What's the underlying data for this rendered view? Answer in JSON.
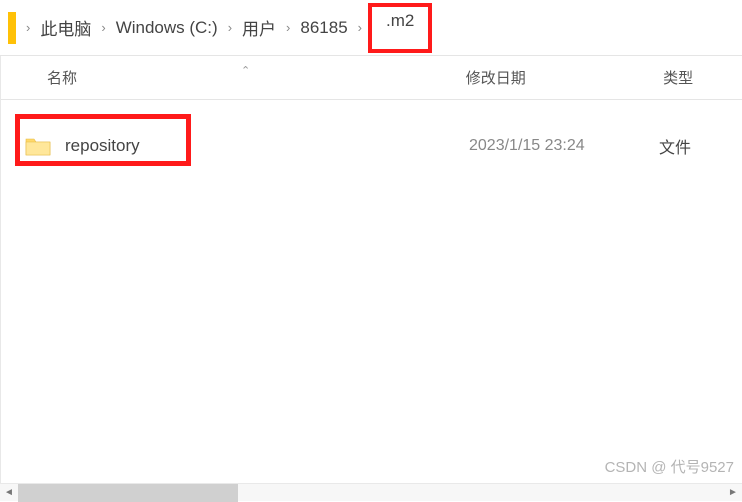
{
  "breadcrumb": {
    "items": [
      {
        "label": "此电脑"
      },
      {
        "label": "Windows (C:)"
      },
      {
        "label": "用户"
      },
      {
        "label": "86185"
      },
      {
        "label": ".m2"
      }
    ]
  },
  "columns": {
    "name": "名称",
    "modified": "修改日期",
    "type": "类型"
  },
  "files": [
    {
      "name": "repository",
      "modified": "2023/1/15 23:24",
      "type": "文件"
    }
  ],
  "watermark": "CSDN @ 代号9527"
}
